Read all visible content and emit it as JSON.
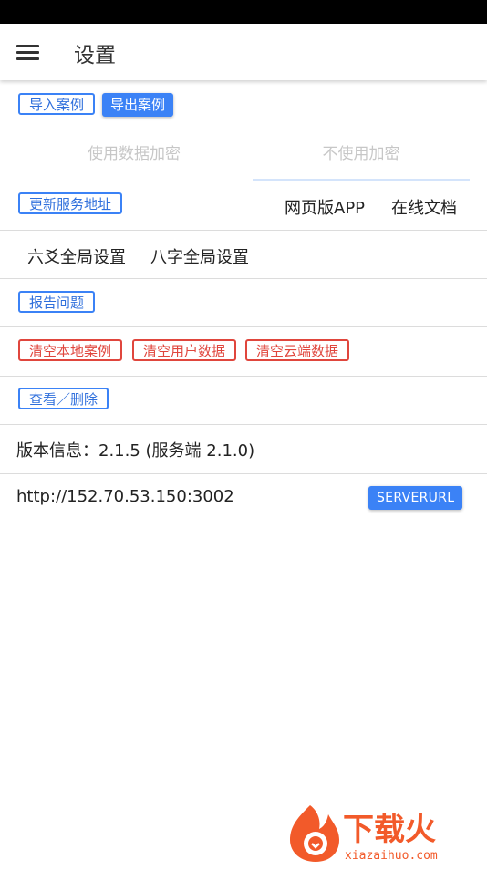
{
  "app_bar": {
    "title": "设置"
  },
  "case_row": {
    "import_label": "导入案例",
    "export_label": "导出案例"
  },
  "encryption_tabs": {
    "tabs": [
      "使用数据加密",
      "不使用加密"
    ],
    "selected": "不使用加密"
  },
  "service_row": {
    "update_label": "更新服务地址",
    "web_app_label": "网页版APP",
    "docs_label": "在线文档"
  },
  "global_row": {
    "liuyao_label": "六爻全局设置",
    "bazi_label": "八字全局设置"
  },
  "report_row": {
    "report_label": "报告问题"
  },
  "clear_row": {
    "local_label": "清空本地案例",
    "user_label": "清空用户数据",
    "cloud_label": "清空云端数据"
  },
  "view_row": {
    "view_label": "查看／删除"
  },
  "version_row": {
    "text": "版本信息：2.1.5 (服务端 2.1.0)"
  },
  "server_row": {
    "url": "http://152.70.53.150:3002",
    "button_label": "SERVERURL"
  },
  "watermark": {
    "brand": "下载火",
    "domain": "xiazaihuo.com"
  },
  "colors": {
    "primary": "#3b82f6",
    "danger": "#e0463d",
    "brand_orange": "#f25a2a"
  }
}
